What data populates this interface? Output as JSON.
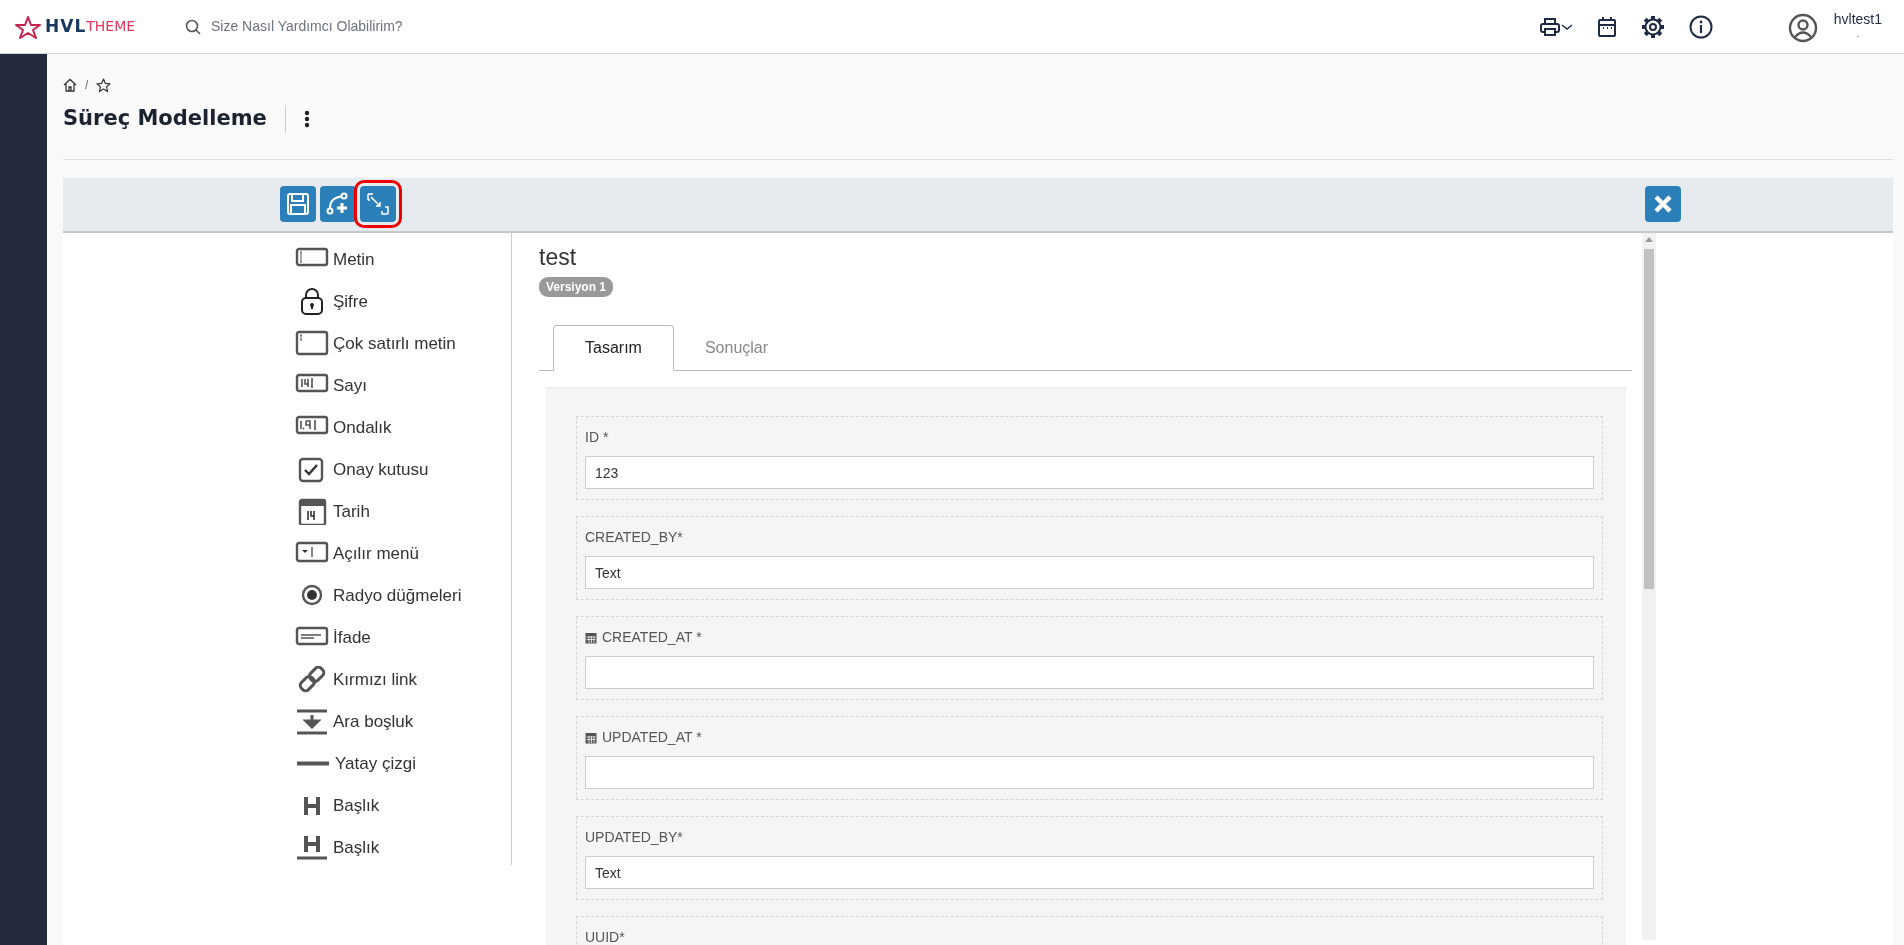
{
  "header": {
    "logo": {
      "strong": "HVL",
      "light": "THEME"
    },
    "search": {
      "placeholder": "Size Nasıl Yardımcı Olabilirim?"
    },
    "user": {
      "name": "hvltest1",
      "subtitle": "-"
    }
  },
  "breadcrumb": {
    "separator": "/"
  },
  "page_title": "Süreç Modelleme",
  "toolbar": {
    "buttons": [
      {
        "kind": "save",
        "highlighted": false
      },
      {
        "kind": "add-flow",
        "highlighted": false
      },
      {
        "kind": "resize",
        "highlighted": true
      }
    ]
  },
  "palette": [
    {
      "kind": "text",
      "label": "Metin"
    },
    {
      "kind": "password",
      "label": "Şifre"
    },
    {
      "kind": "textarea",
      "label": "Çok satırlı metin"
    },
    {
      "kind": "number",
      "label": "Sayı"
    },
    {
      "kind": "decimal",
      "label": "Ondalık"
    },
    {
      "kind": "checkbox",
      "label": "Onay kutusu"
    },
    {
      "kind": "date",
      "label": "Tarih"
    },
    {
      "kind": "dropdown",
      "label": "Açılır menü"
    },
    {
      "kind": "radio",
      "label": "Radyo düğmeleri"
    },
    {
      "kind": "expression",
      "label": "İfade"
    },
    {
      "kind": "link",
      "label": "Kırmızı link"
    },
    {
      "kind": "spacer",
      "label": "Ara boşluk"
    },
    {
      "kind": "rule",
      "label": "Yatay çizgi"
    },
    {
      "kind": "heading",
      "label": "Başlık"
    },
    {
      "kind": "heading-underlined",
      "label": "Başlık"
    }
  ],
  "form": {
    "title": "test",
    "version": "Versiyon 1",
    "tabs": [
      {
        "label": "Tasarım",
        "selected": true
      },
      {
        "label": "Sonuçlar",
        "selected": false
      }
    ],
    "fields": [
      {
        "label": "ID *",
        "kind": "text",
        "value": "123"
      },
      {
        "label": "CREATED_BY*",
        "kind": "text",
        "value": "Text"
      },
      {
        "label": "CREATED_AT *",
        "kind": "date"
      },
      {
        "label": "UPDATED_AT *",
        "kind": "date"
      },
      {
        "label": "UPDATED_BY*",
        "kind": "text",
        "value": "Text"
      },
      {
        "label": "UUID*",
        "kind": "text"
      }
    ]
  }
}
